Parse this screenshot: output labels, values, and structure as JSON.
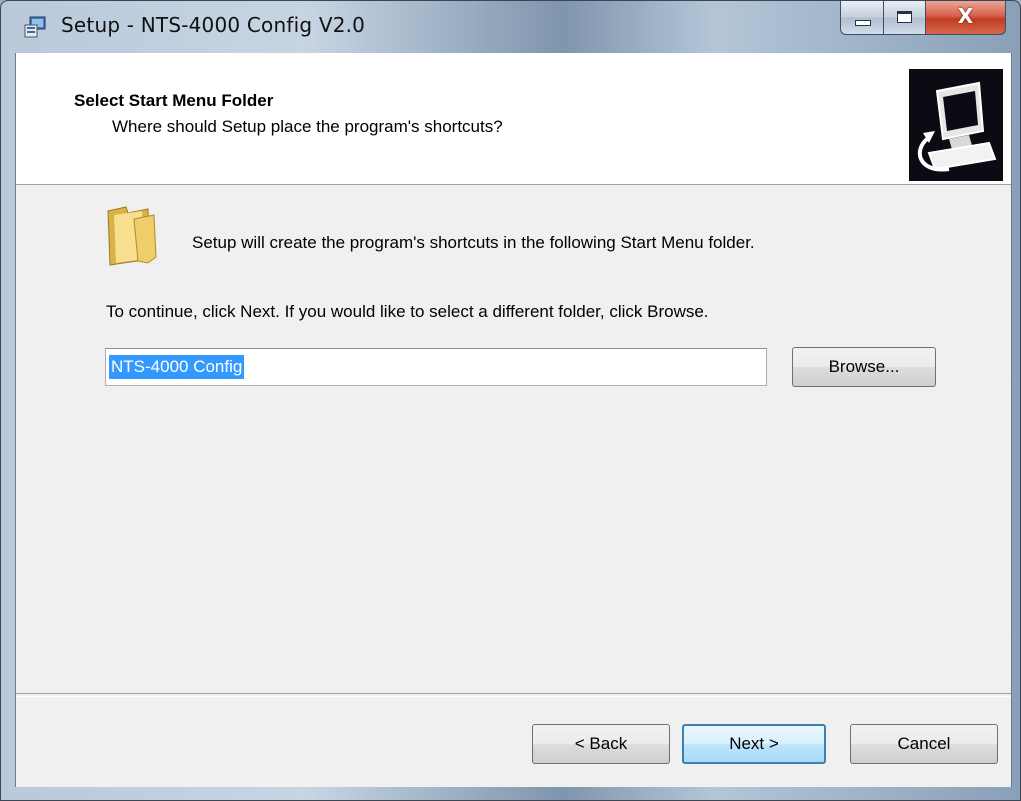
{
  "window": {
    "title": "Setup - NTS-4000 Config V2.0",
    "close_glyph": "X"
  },
  "header": {
    "title": "Select Start Menu Folder",
    "subtitle": "Where should Setup place the program's shortcuts?"
  },
  "body": {
    "intro": "Setup will create the program's shortcuts in the following Start Menu folder.",
    "instruction": "To continue, click Next. If you would like to select a different folder, click Browse.",
    "folder_value": "NTS-4000 Config",
    "browse_label": "Browse..."
  },
  "footer": {
    "back_label": "< Back",
    "next_label": "Next >",
    "cancel_label": "Cancel"
  },
  "colors": {
    "selection": "#3399ff",
    "close_button": "#c13c22",
    "default_button_border": "#3c7fb1"
  },
  "icons": [
    "setup-app-icon",
    "minimize-icon",
    "maximize-icon",
    "close-icon",
    "computer-wizard-icon",
    "folder-icon"
  ]
}
